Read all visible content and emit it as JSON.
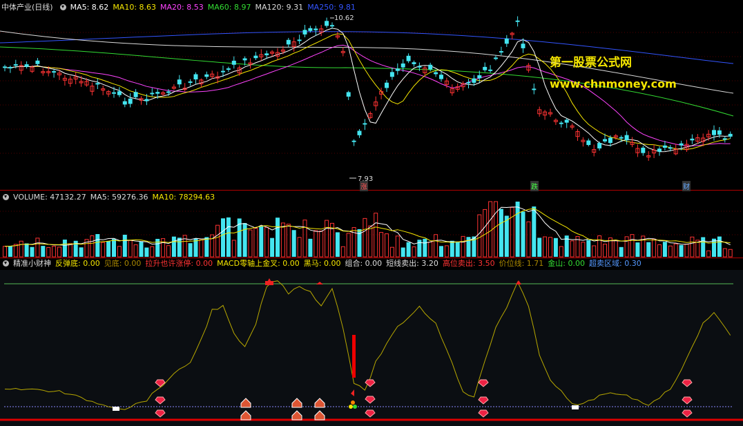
{
  "main_chart": {
    "title": "中体产业(日线)",
    "indicators": [
      {
        "label": "MA5: 8.62",
        "color": "#ffffff"
      },
      {
        "label": "MA10: 8.63",
        "color": "#f5e600"
      },
      {
        "label": "MA20: 8.53",
        "color": "#ff44ff"
      },
      {
        "label": "MA60: 8.97",
        "color": "#33dd33"
      },
      {
        "label": "MA120: 9.31",
        "color": "#dddddd"
      },
      {
        "label": "MA250: 9.81",
        "color": "#3355ff"
      }
    ],
    "high_label": "10.62",
    "low_label": "7.93",
    "markers": [
      "涨",
      "跌",
      "财"
    ],
    "watermark_cn": "第一股票公式网",
    "watermark_url": "www.chnmoney.com"
  },
  "volume_chart": {
    "indicators": [
      {
        "label": "VOLUME: 47132.27",
        "color": "#dddddd"
      },
      {
        "label": "MA5: 59276.36",
        "color": "#dddddd"
      },
      {
        "label": "MA10: 78294.63",
        "color": "#f5e600"
      }
    ]
  },
  "indicator_chart": {
    "indicators": [
      {
        "label": "精准小财神",
        "color": "#dddddd"
      },
      {
        "label": "反弹底: 0.00",
        "color": "#f5e600"
      },
      {
        "label": "见底: 0.00",
        "color": "#aa8800"
      },
      {
        "label": "拉升也许涨停: 0.00",
        "color": "#ff3333"
      },
      {
        "label": "MACD零轴上金叉: 0.00",
        "color": "#f5e600"
      },
      {
        "label": "黑马: 0.00",
        "color": "#f5e600"
      },
      {
        "label": "组合: 0.00",
        "color": "#dddddd"
      },
      {
        "label": "短线卖出: 3.20",
        "color": "#dddddd"
      },
      {
        "label": "高位卖出: 3.50",
        "color": "#ff3333"
      },
      {
        "label": "价位线: 1.71",
        "color": "#aa8800"
      },
      {
        "label": "金山: 0.00",
        "color": "#33dd33"
      },
      {
        "label": "超卖区域: 0.30",
        "color": "#5599ff"
      }
    ]
  },
  "colors": {
    "up": "#ff3333",
    "down": "#44e5f0",
    "bg": "#000000",
    "frame": "#b00000"
  }
}
